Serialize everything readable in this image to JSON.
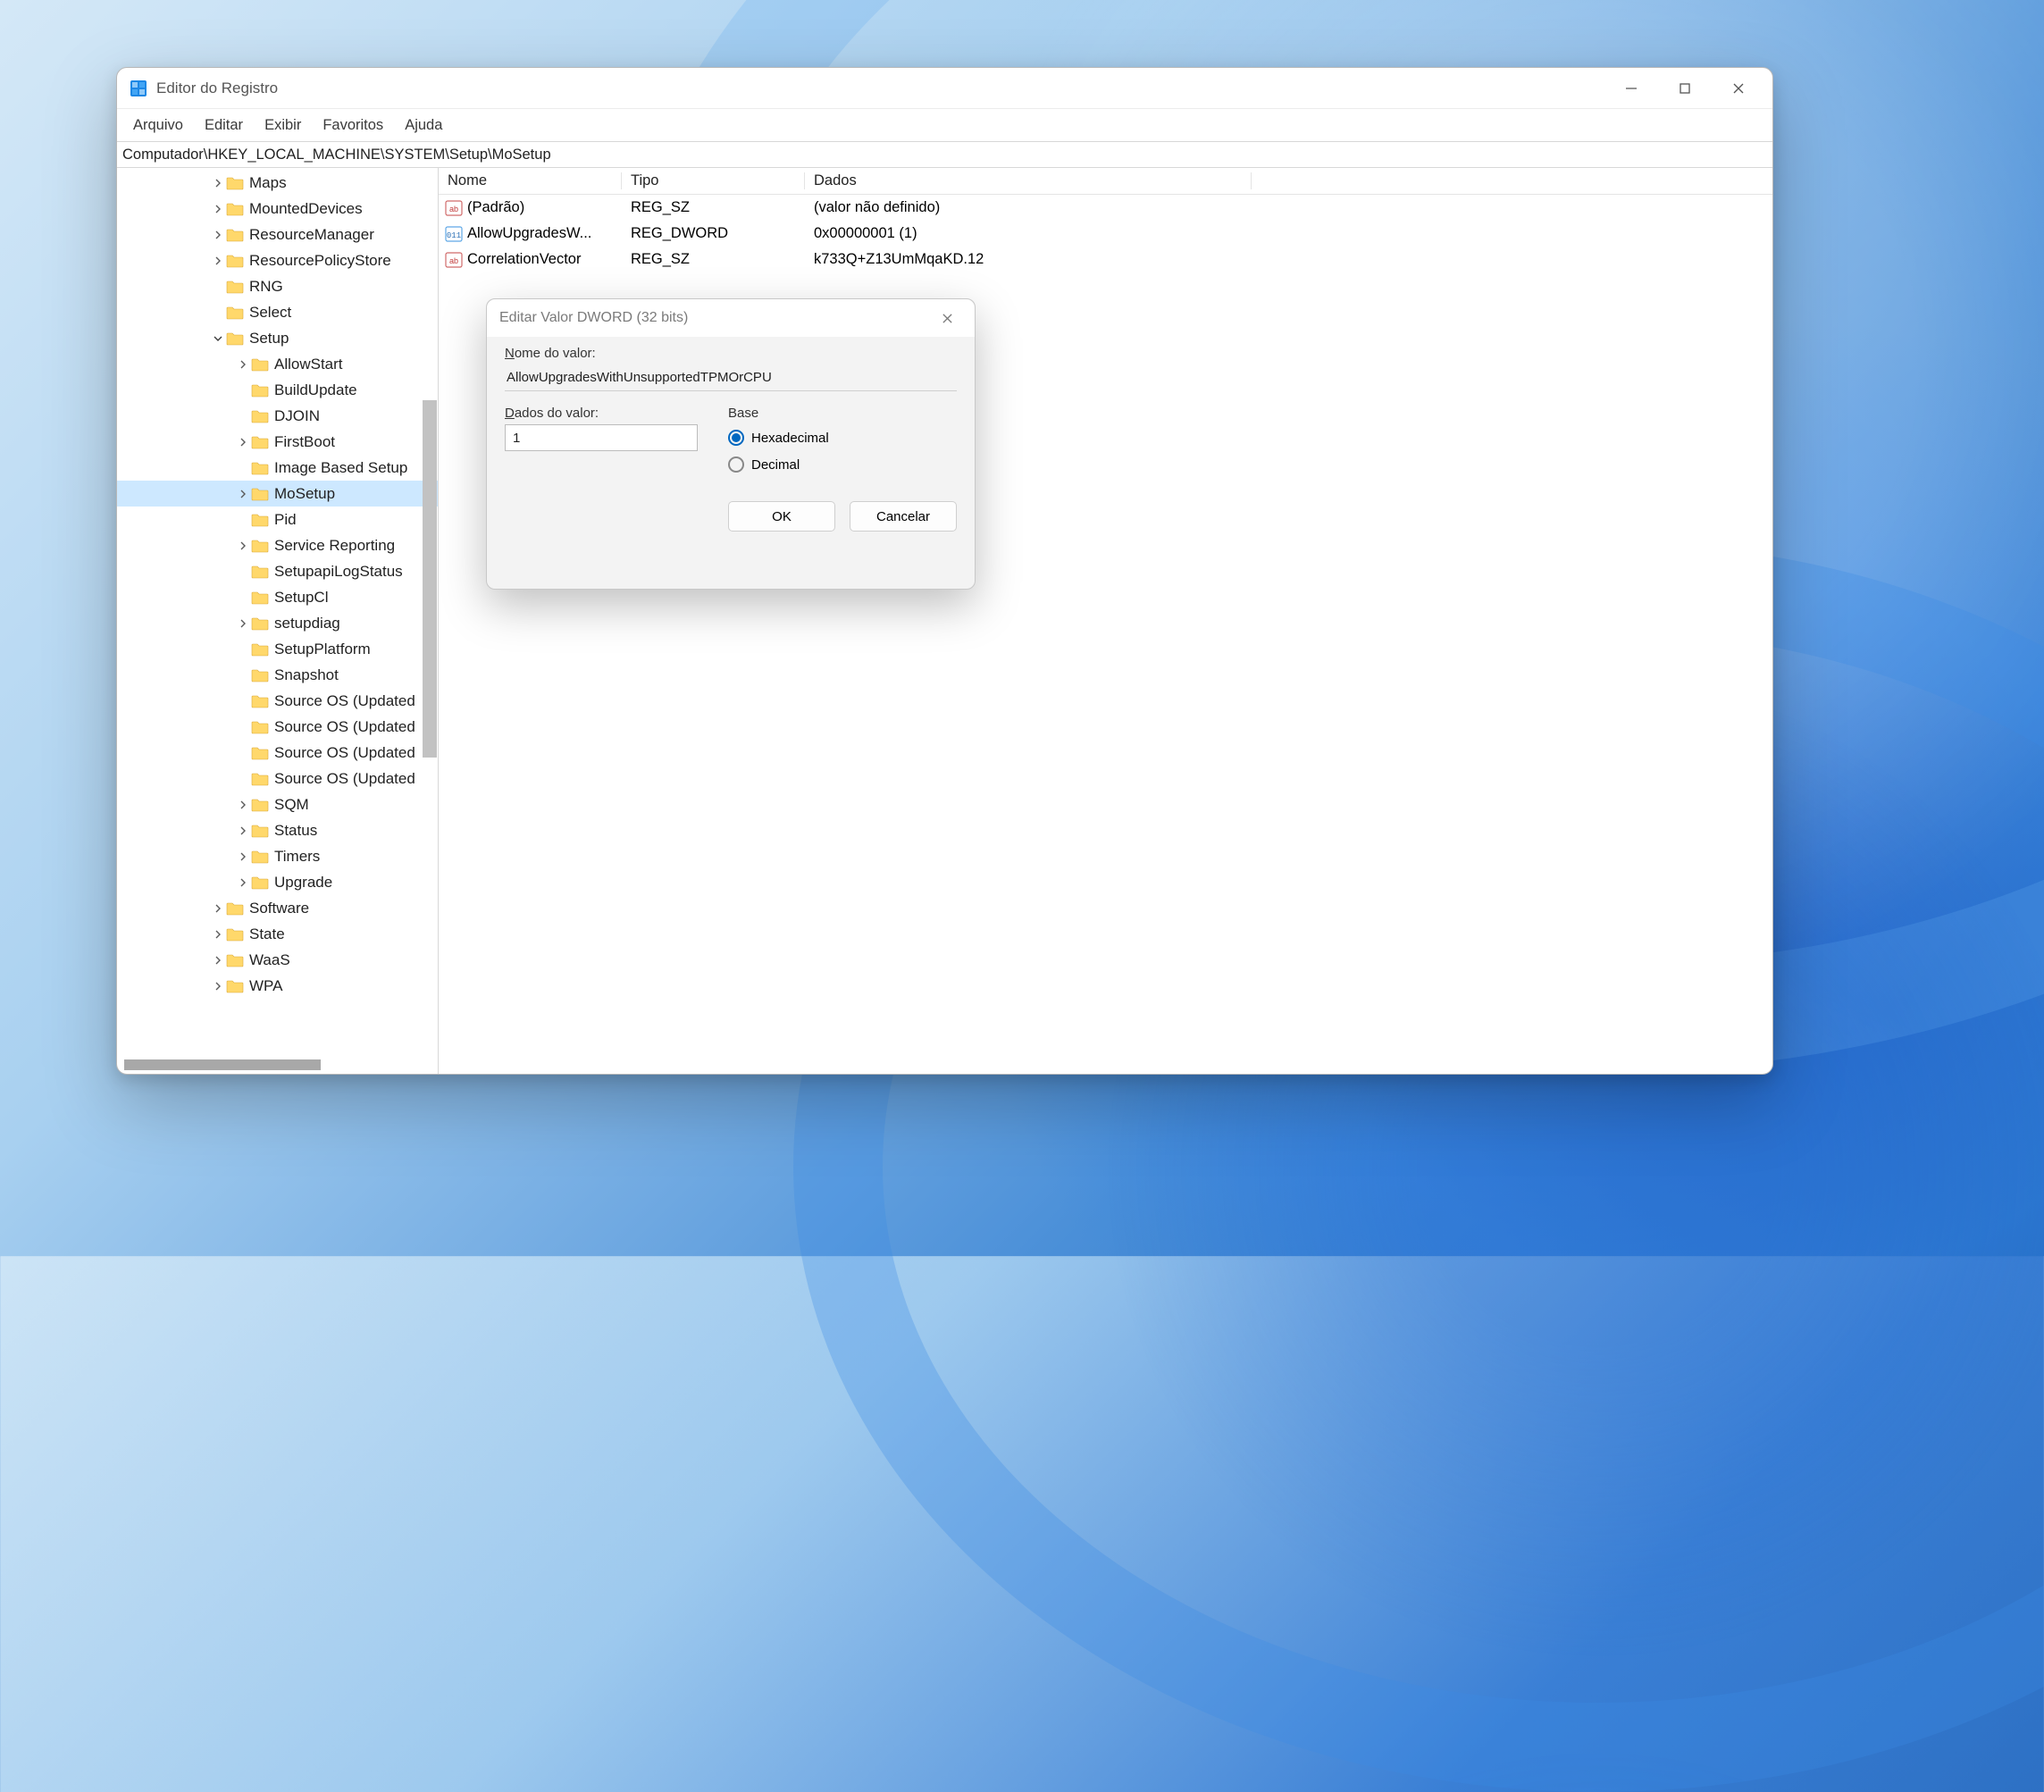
{
  "window": {
    "title": "Editor do Registro",
    "menu": [
      "Arquivo",
      "Editar",
      "Exibir",
      "Favoritos",
      "Ajuda"
    ],
    "address": "Computador\\HKEY_LOCAL_MACHINE\\SYSTEM\\Setup\\MoSetup"
  },
  "tree": [
    {
      "indent": 3,
      "exp": "›",
      "label": "Maps"
    },
    {
      "indent": 3,
      "exp": "›",
      "label": "MountedDevices"
    },
    {
      "indent": 3,
      "exp": "›",
      "label": "ResourceManager"
    },
    {
      "indent": 3,
      "exp": "›",
      "label": "ResourcePolicyStore"
    },
    {
      "indent": 3,
      "exp": "",
      "label": "RNG"
    },
    {
      "indent": 3,
      "exp": "",
      "label": "Select"
    },
    {
      "indent": 3,
      "exp": "⌄",
      "label": "Setup"
    },
    {
      "indent": 4,
      "exp": "›",
      "label": "AllowStart"
    },
    {
      "indent": 4,
      "exp": "",
      "label": "BuildUpdate"
    },
    {
      "indent": 4,
      "exp": "",
      "label": "DJOIN"
    },
    {
      "indent": 4,
      "exp": "›",
      "label": "FirstBoot"
    },
    {
      "indent": 4,
      "exp": "",
      "label": "Image Based Setup"
    },
    {
      "indent": 4,
      "exp": "›",
      "label": "MoSetup",
      "selected": true
    },
    {
      "indent": 4,
      "exp": "",
      "label": "Pid"
    },
    {
      "indent": 4,
      "exp": "›",
      "label": "Service Reporting"
    },
    {
      "indent": 4,
      "exp": "",
      "label": "SetupapiLogStatus"
    },
    {
      "indent": 4,
      "exp": "",
      "label": "SetupCl"
    },
    {
      "indent": 4,
      "exp": "›",
      "label": "setupdiag"
    },
    {
      "indent": 4,
      "exp": "",
      "label": "SetupPlatform"
    },
    {
      "indent": 4,
      "exp": "",
      "label": "Snapshot"
    },
    {
      "indent": 4,
      "exp": "",
      "label": "Source OS (Updated"
    },
    {
      "indent": 4,
      "exp": "",
      "label": "Source OS (Updated"
    },
    {
      "indent": 4,
      "exp": "",
      "label": "Source OS (Updated"
    },
    {
      "indent": 4,
      "exp": "",
      "label": "Source OS (Updated"
    },
    {
      "indent": 4,
      "exp": "›",
      "label": "SQM"
    },
    {
      "indent": 4,
      "exp": "›",
      "label": "Status"
    },
    {
      "indent": 4,
      "exp": "›",
      "label": "Timers"
    },
    {
      "indent": 4,
      "exp": "›",
      "label": "Upgrade"
    },
    {
      "indent": 3,
      "exp": "›",
      "label": "Software"
    },
    {
      "indent": 3,
      "exp": "›",
      "label": "State"
    },
    {
      "indent": 3,
      "exp": "›",
      "label": "WaaS"
    },
    {
      "indent": 3,
      "exp": "›",
      "label": "WPA"
    }
  ],
  "list": {
    "headers": {
      "name": "Nome",
      "type": "Tipo",
      "data": "Dados"
    },
    "rows": [
      {
        "icon": "sz",
        "name": "(Padrão)",
        "type": "REG_SZ",
        "data": "(valor não definido)"
      },
      {
        "icon": "dw",
        "name": "AllowUpgradesW...",
        "type": "REG_DWORD",
        "data": "0x00000001 (1)"
      },
      {
        "icon": "sz",
        "name": "CorrelationVector",
        "type": "REG_SZ",
        "data": "k733Q+Z13UmMqaKD.12"
      }
    ]
  },
  "dialog": {
    "title": "Editar Valor DWORD (32 bits)",
    "name_label": "Nome do valor:",
    "name_value": "AllowUpgradesWithUnsupportedTPMOrCPU",
    "data_label_pre": "D",
    "data_label_post": "ados do valor:",
    "data_value": "1",
    "base_label": "Base",
    "hex_pre": "H",
    "hex_post": "exadecimal",
    "dec_pre": "D",
    "dec_post": "ecimal",
    "hex_checked": true,
    "ok": "OK",
    "cancel": "Cancelar"
  }
}
